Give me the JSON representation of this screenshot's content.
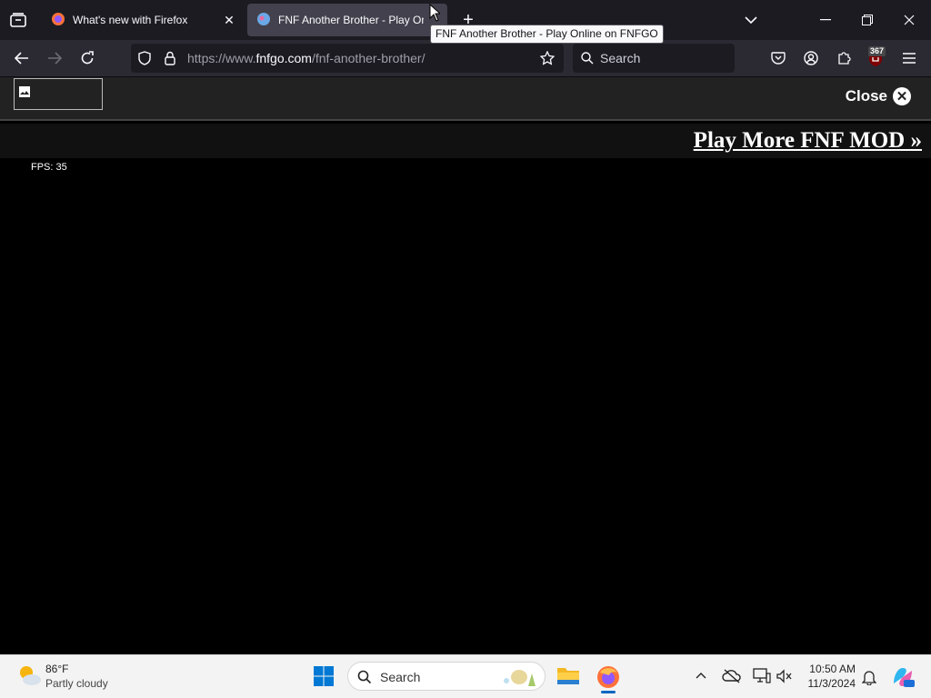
{
  "browser": {
    "tabs": [
      {
        "title": "What's new with Firefox",
        "active": false
      },
      {
        "title": "FNF Another Brother - Play Online on FNFGO",
        "active": true
      }
    ],
    "tooltip": "FNF Another Brother - Play Online on FNFGO",
    "url": {
      "prefix": "https://www.",
      "host": "fnfgo.com",
      "path": "/fnf-another-brother/"
    },
    "search_placeholder": "Search",
    "extension_badge": "367"
  },
  "page": {
    "close_label": "Close",
    "more_link": "Play More FNF MOD »",
    "fps_text": "FPS: 35"
  },
  "taskbar": {
    "weather": {
      "temp": "86°F",
      "desc": "Partly cloudy"
    },
    "search_placeholder": "Search",
    "time": "10:50 AM",
    "date": "11/3/2024"
  },
  "colors": {
    "accent": "#0067c0",
    "toolbar": "#2b2a33",
    "tabstrip": "#1c1b22"
  }
}
